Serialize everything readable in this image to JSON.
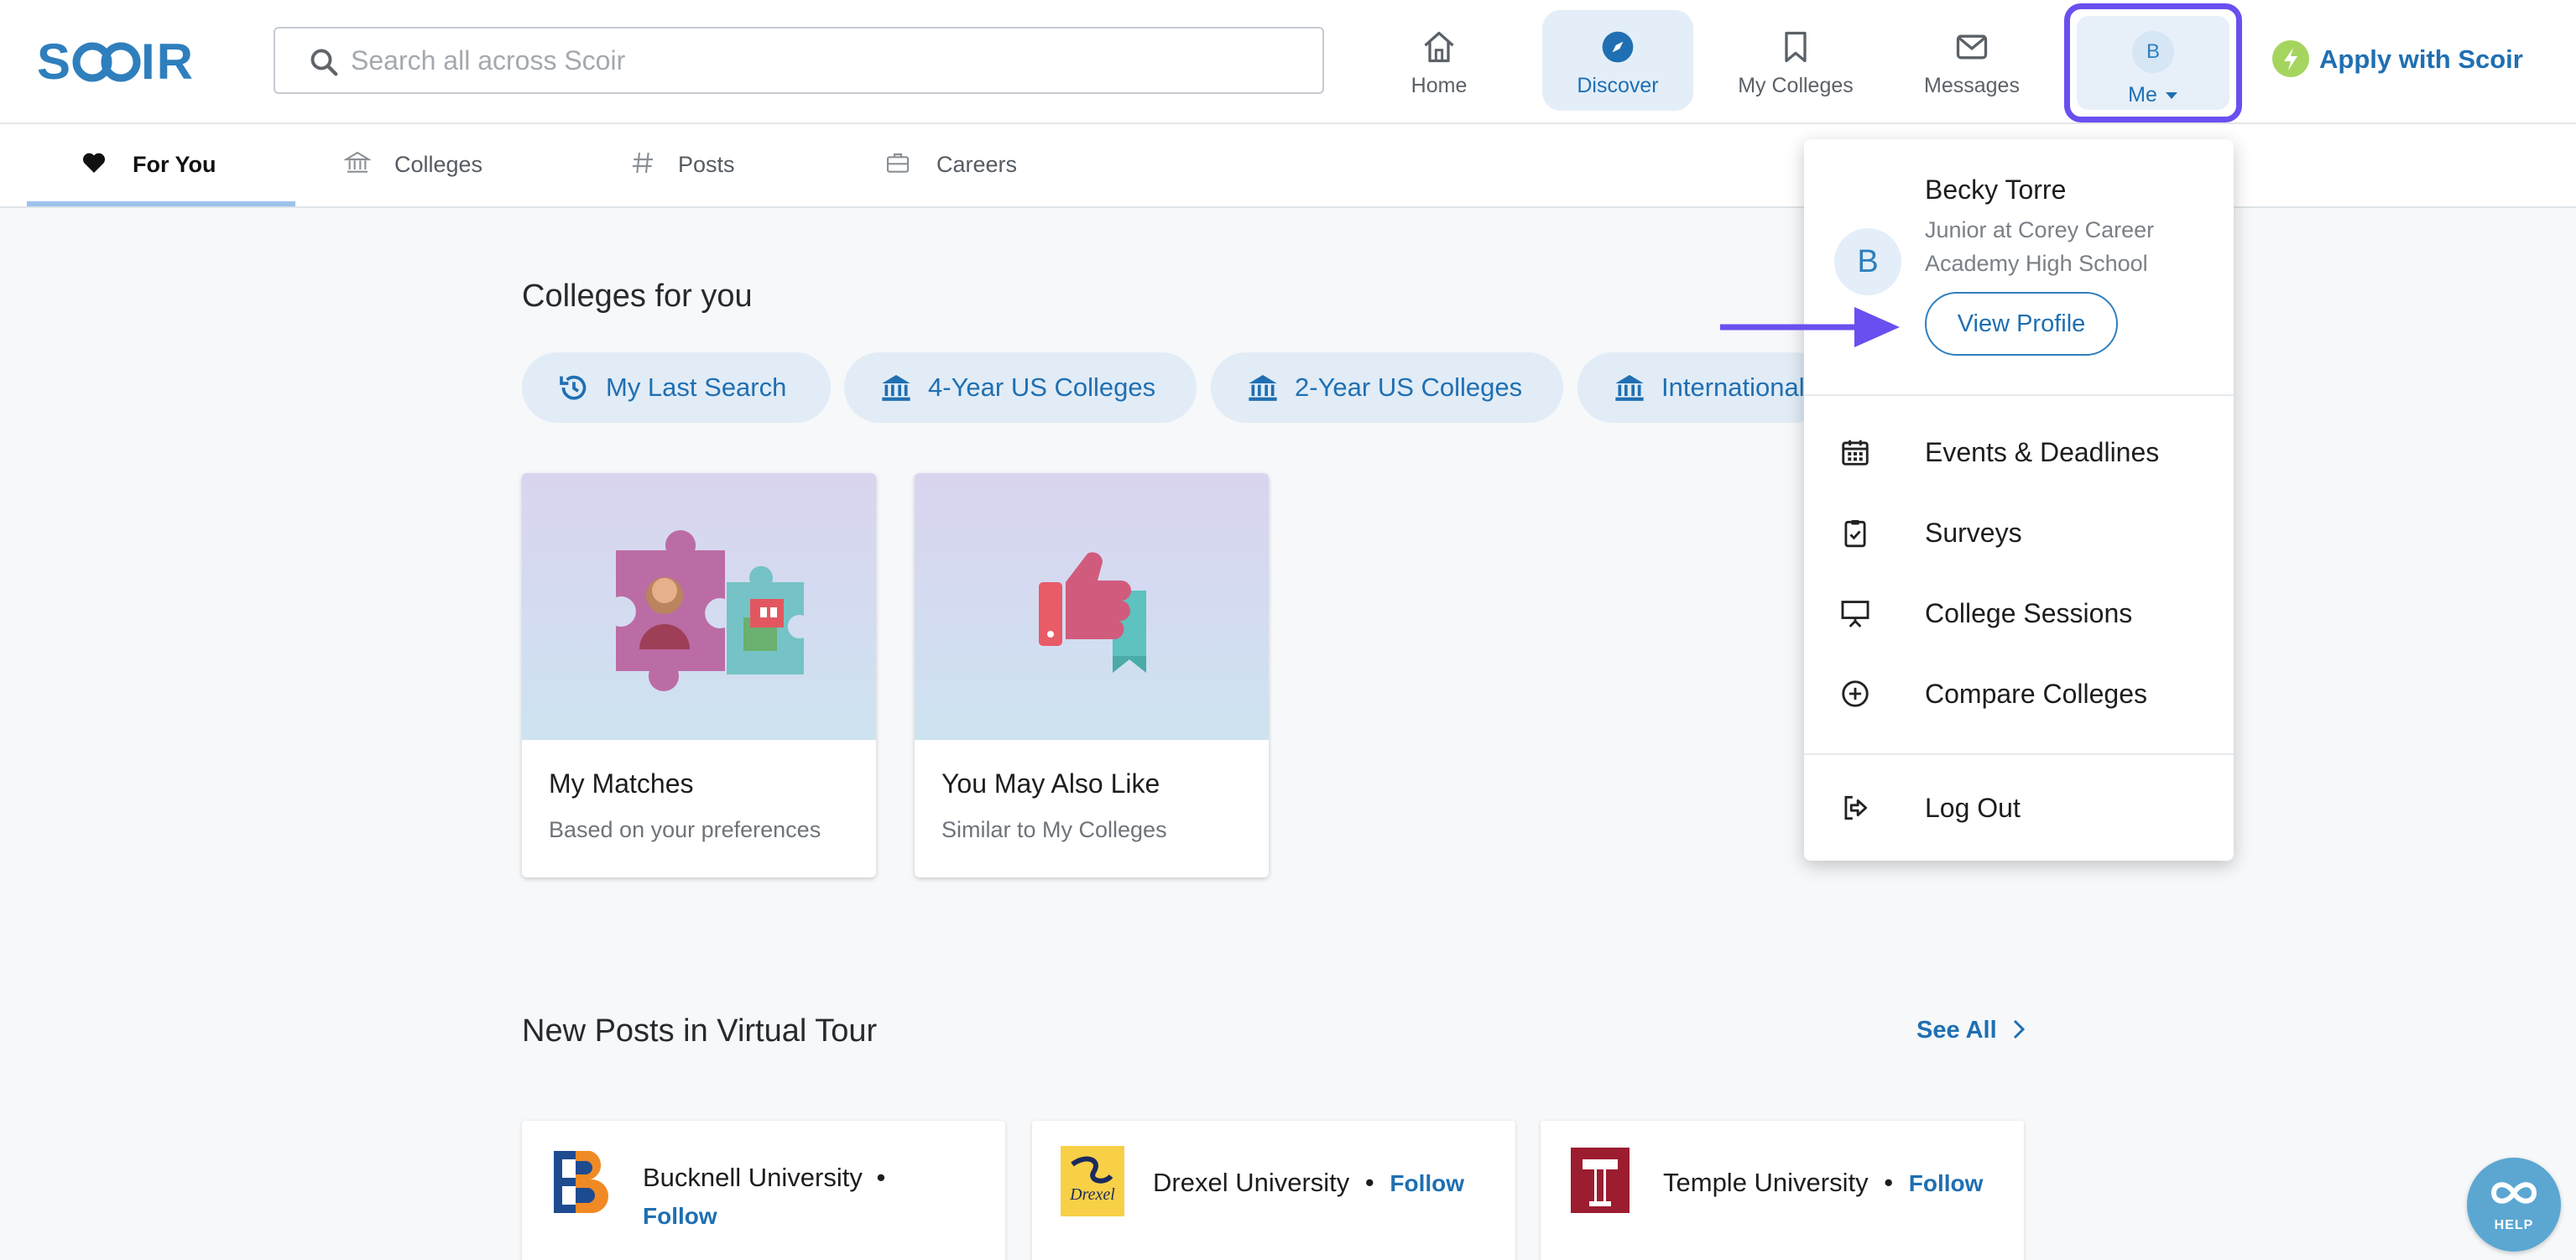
{
  "brand": {
    "name": "SCOIR"
  },
  "search": {
    "placeholder": "Search all across Scoir"
  },
  "topnav": {
    "home": "Home",
    "discover": "Discover",
    "my_colleges": "My Colleges",
    "messages": "Messages",
    "me": "Me",
    "me_avatar": "B",
    "apply": "Apply with Scoir"
  },
  "subnav": {
    "for_you": "For You",
    "colleges": "Colleges",
    "posts": "Posts",
    "careers": "Careers"
  },
  "colleges_for_you": {
    "title": "Colleges for you",
    "pills": [
      "My Last Search",
      "4-Year US Colleges",
      "2-Year US Colleges",
      "International"
    ],
    "cards": [
      {
        "title": "My Matches",
        "subtitle": "Based on your preferences"
      },
      {
        "title": "You May Also Like",
        "subtitle": "Similar to My Colleges"
      }
    ]
  },
  "virtual_tour": {
    "title": "New Posts in Virtual Tour",
    "see_all": "See All",
    "posts": [
      {
        "university": "Bucknell University",
        "follow": "Follow",
        "separator": "•"
      },
      {
        "university": "Drexel University",
        "follow": "Follow",
        "separator": "•"
      },
      {
        "university": "Temple University",
        "follow": "Follow",
        "separator": "•"
      }
    ]
  },
  "profile_menu": {
    "avatar_letter": "B",
    "name": "Becky Torre",
    "school": "Junior at Corey Career Academy High School",
    "view_profile": "View Profile",
    "items": [
      "Events & Deadlines",
      "Surveys",
      "College Sessions",
      "Compare Colleges"
    ],
    "logout": "Log Out"
  },
  "help": {
    "label": "HELP"
  },
  "colors": {
    "accent": "#1f6fb2",
    "highlight": "#6a4ff0",
    "pill_bg": "#e1ecf6",
    "apply_bolt": "#a5d55f"
  }
}
